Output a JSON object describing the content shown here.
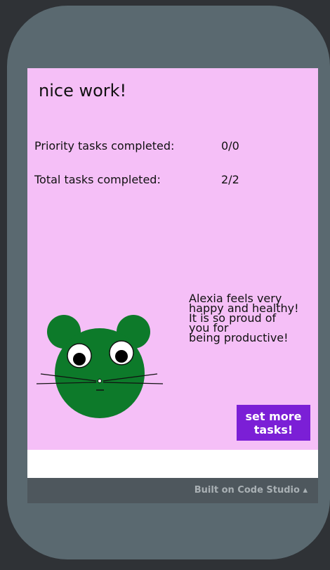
{
  "colors": {
    "screen_bg": "#f5bff7",
    "button_bg": "#7b1fd6",
    "creature": "#0d7a2a",
    "phone_frame": "#5a6970",
    "footer_bg": "#4e575d"
  },
  "screen": {
    "title": "nice work!",
    "stats": [
      {
        "label": "Priority tasks completed:",
        "value": "0/0"
      },
      {
        "label": "Total tasks completed:",
        "value": "2/2"
      }
    ],
    "message": "Alexia  feels very\nhappy and healthy!\nIt is so proud of\nyou for\nbeing productive!",
    "button_label": "set more\ntasks!"
  },
  "footer": {
    "text": "Built on Code Studio ▴"
  }
}
